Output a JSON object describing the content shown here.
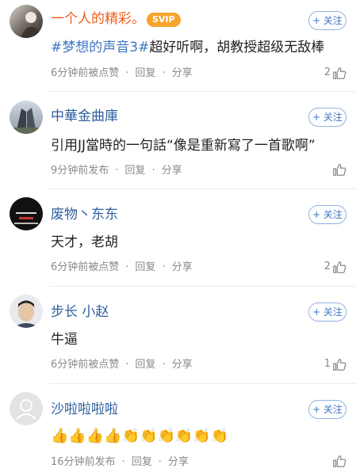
{
  "comments": [
    {
      "username": "一个人的精彩。",
      "badge": "SVIP",
      "follow_label": "+ 关注",
      "content_tag": "#梦想的声音3#",
      "content_text": "超好听啊，胡教授超级无敌棒",
      "time_action": "6分钟前被点赞",
      "reply_label": "回复",
      "share_label": "分享",
      "like_count": "2"
    },
    {
      "username": "中華金曲庫",
      "follow_label": "+ 关注",
      "content_text": "引用JJ當時的一句話“像是重新寫了一首歌啊”",
      "time_action": "9分钟前发布",
      "reply_label": "回复",
      "share_label": "分享",
      "like_count": ""
    },
    {
      "username": "废物丶东东",
      "follow_label": "+ 关注",
      "content_text": "天才，老胡",
      "time_action": "6分钟前被点赞",
      "reply_label": "回复",
      "share_label": "分享",
      "like_count": "2"
    },
    {
      "username": "步长  小赵",
      "follow_label": "+ 关注",
      "content_text": "牛逼",
      "time_action": "6分钟前被点赞",
      "reply_label": "回复",
      "share_label": "分享",
      "like_count": "1"
    },
    {
      "username": "沙啦啦啦啦",
      "follow_label": "+ 关注",
      "content_text": "👍👍👍👍👏👏👏👏👏👏",
      "time_action": "16分钟前发布",
      "reply_label": "回复",
      "share_label": "分享",
      "like_count": ""
    }
  ],
  "colors": {
    "orange_name": "#f25b18",
    "blue_name": "#2f5e9e",
    "link_blue": "#3f76c4",
    "vip_badge": "#f7a42b"
  },
  "icons": [
    "thumbs-up-icon",
    "default-avatar-icon"
  ]
}
